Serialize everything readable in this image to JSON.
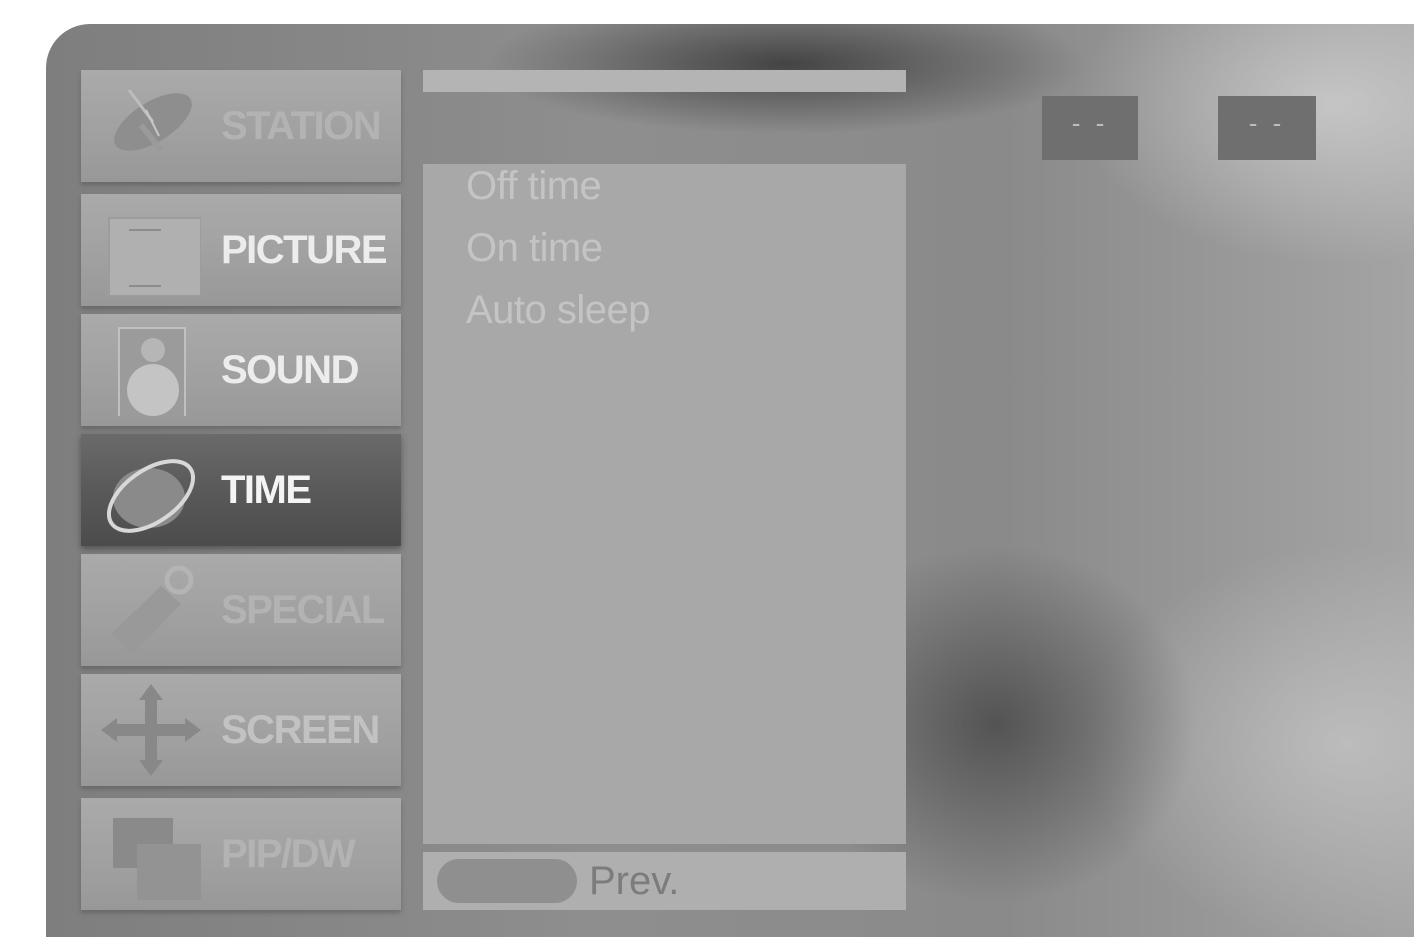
{
  "menu": {
    "items": [
      {
        "label": "STATION",
        "icon": "satellite-dish-icon"
      },
      {
        "label": "PICTURE",
        "icon": "picture-frame-icon"
      },
      {
        "label": "SOUND",
        "icon": "speaker-icon"
      },
      {
        "label": "TIME",
        "icon": "clock-ring-icon"
      },
      {
        "label": "SPECIAL",
        "icon": "tag-icon"
      },
      {
        "label": "SCREEN",
        "icon": "move-arrows-icon"
      },
      {
        "label": "PIP/DW",
        "icon": "pip-windows-icon"
      }
    ],
    "selected": "TIME"
  },
  "submenu": {
    "items": [
      {
        "label": "Off time"
      },
      {
        "label": "On time"
      },
      {
        "label": "Auto sleep"
      }
    ]
  },
  "footer": {
    "prev_label": "Prev."
  },
  "values": {
    "hours": "- -",
    "minutes": "- -"
  },
  "colors": {
    "selected_item": "#585858",
    "menu_item": "#a4a4a4",
    "panel": "#a8a8a8"
  }
}
